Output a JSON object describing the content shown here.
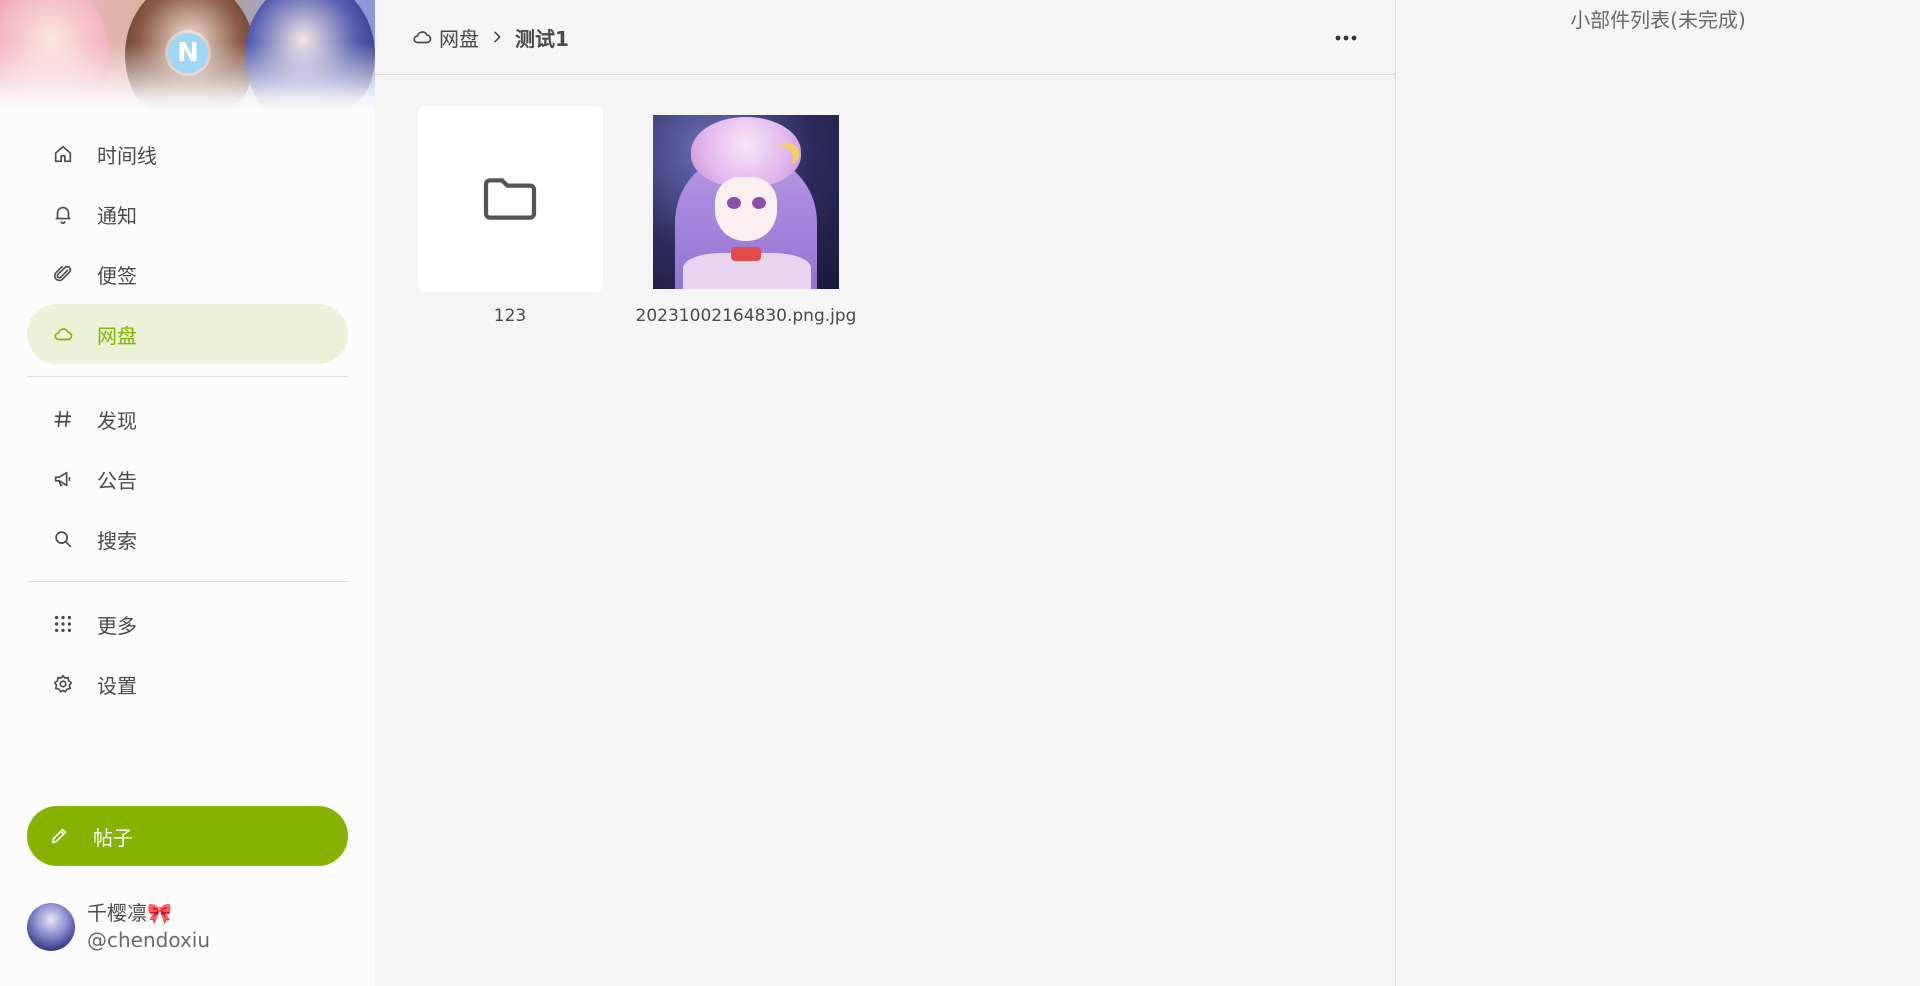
{
  "sidebar": {
    "logo_letter": "N",
    "nav_primary": [
      {
        "label": "时间线",
        "icon": "home-icon"
      },
      {
        "label": "通知",
        "icon": "bell-icon"
      },
      {
        "label": "便签",
        "icon": "paperclip-icon"
      },
      {
        "label": "网盘",
        "icon": "cloud-icon",
        "active": true
      }
    ],
    "nav_secondary": [
      {
        "label": "发现",
        "icon": "hashtag-icon"
      },
      {
        "label": "公告",
        "icon": "megaphone-icon"
      },
      {
        "label": "搜索",
        "icon": "search-icon"
      }
    ],
    "nav_tertiary": [
      {
        "label": "更多",
        "icon": "grid-dots-icon"
      },
      {
        "label": "设置",
        "icon": "gear-icon"
      }
    ],
    "post_button_label": "帖子",
    "account": {
      "display_name": "千樱凛🎀",
      "handle": "@chendoxiu"
    }
  },
  "main": {
    "breadcrumb": {
      "root": "网盘",
      "current": "测试1"
    },
    "items": [
      {
        "name": "123",
        "type": "folder"
      },
      {
        "name": "20231002164830.png.jpg",
        "type": "image"
      }
    ]
  },
  "right_panel": {
    "title": "小部件列表(未完成)"
  },
  "colors": {
    "accent": "#86b300",
    "accent_bg": "#ebf2d8",
    "background": "#f5f5f5",
    "text": "#4a4a4a"
  }
}
